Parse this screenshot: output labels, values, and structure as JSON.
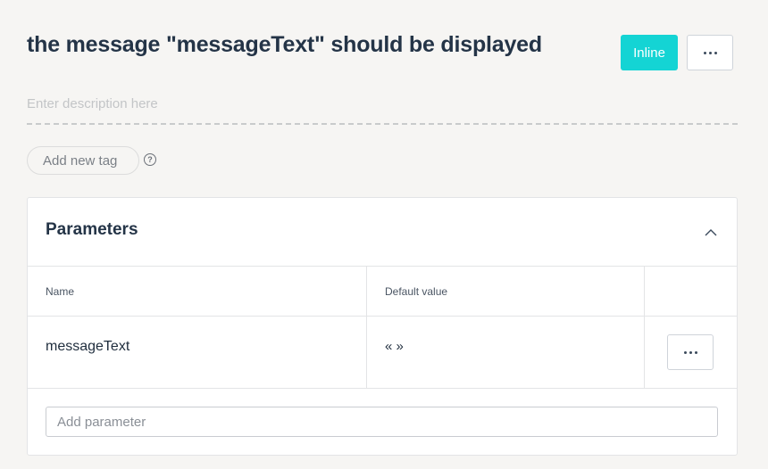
{
  "header": {
    "title": "the message \"messageText\" should be displayed",
    "inline_label": "Inline",
    "more_icon": "ellipsis-horizontal-icon"
  },
  "description": {
    "placeholder": "Enter description here"
  },
  "tags": {
    "add_label": "Add new tag",
    "help_glyph": "?"
  },
  "parameters": {
    "title": "Parameters",
    "collapse_icon": "chevron-up-icon",
    "columns": {
      "name": "Name",
      "default_value": "Default value"
    },
    "rows": [
      {
        "name": "messageText",
        "default_value": "« »"
      }
    ],
    "add_placeholder": "Add parameter"
  },
  "colors": {
    "accent": "#14d4d4",
    "background": "#f6f5f3",
    "title_text": "#243447"
  }
}
